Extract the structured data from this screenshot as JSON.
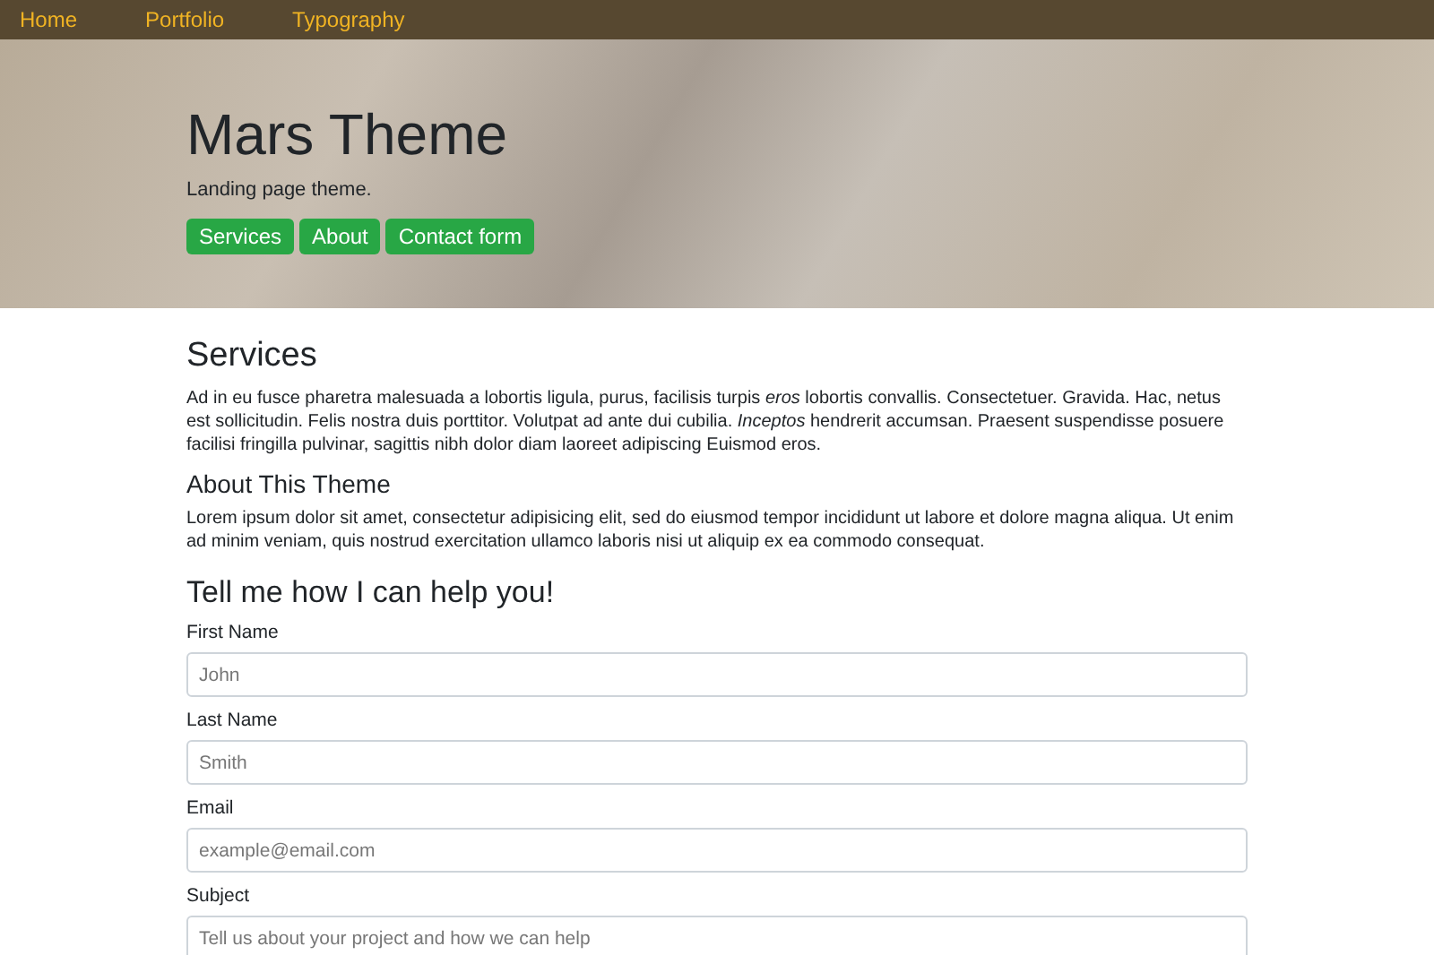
{
  "nav": {
    "links": [
      {
        "label": "Home"
      },
      {
        "label": "Portfolio"
      },
      {
        "label": "Typography"
      }
    ]
  },
  "hero": {
    "title": "Mars Theme",
    "subtitle": "Landing page theme.",
    "buttons": [
      "Services",
      "About",
      "Contact form"
    ]
  },
  "sections": [
    {
      "heading": "Services",
      "kind": "main",
      "text": "Ad in eu fusce pharetra malesuada a lobortis ligula, purus, facilisis turpis *eros* lobortis convallis. Consectetuer. Gravida. Hac, netus est sollicitudin. Felis nostra duis porttitor. Volutpat ad ante dui cubilia. *Inceptos* hendrerit accumsan. Praesent suspendisse posuere facilisi fringilla pulvinar, sagittis nibh dolor diam laoreet adipiscing Euismod eros."
    },
    {
      "heading": "About This Theme",
      "kind": "sub",
      "text": "Lorem ipsum dolor sit amet, consectetur adipisicing elit, sed do eiusmod tempor incididunt ut labore et dolore magna aliqua. Ut enim ad minim veniam, quis nostrud exercitation ullamco laboris nisi ut aliquip ex ea commodo consequat."
    }
  ],
  "form": {
    "heading": "Tell me how I can help you!",
    "fields": [
      {
        "label": "First Name",
        "placeholder": "John"
      },
      {
        "label": "Last Name",
        "placeholder": "Smith"
      },
      {
        "label": "Email",
        "placeholder": "example@email.com"
      },
      {
        "label": "Subject",
        "placeholder": "Tell us about your project and how we can help"
      }
    ]
  }
}
